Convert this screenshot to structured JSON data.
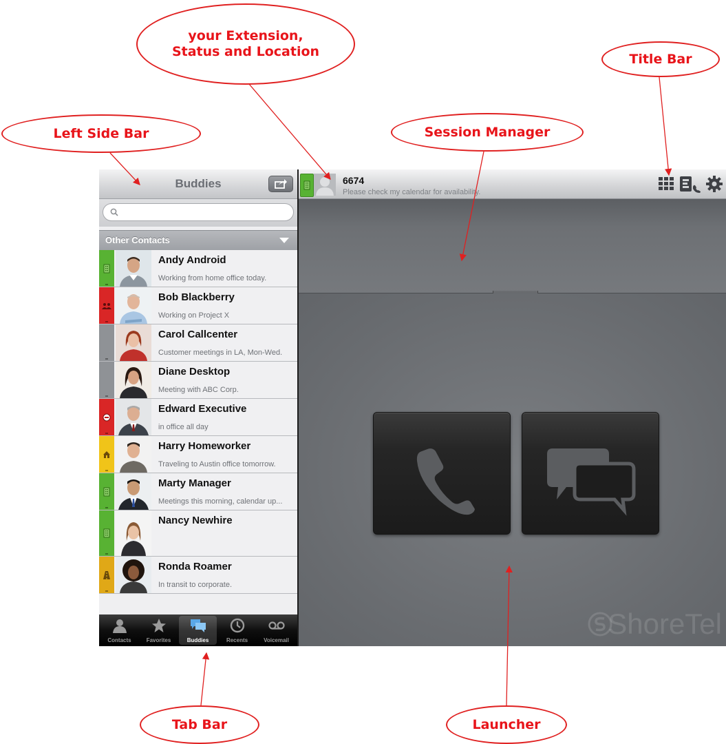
{
  "annotations": {
    "extension_status_location": [
      "your Extension,",
      "Status and Location"
    ],
    "title_bar": "Title Bar",
    "left_side_bar": "Left Side Bar",
    "session_manager": "Session Manager",
    "tab_bar": "Tab Bar",
    "launcher": "Launcher"
  },
  "sidebar": {
    "title": "Buddies",
    "search": {
      "placeholder": "",
      "value": ""
    },
    "group": "Other Contacts",
    "buddies": [
      {
        "name": "Andy Android",
        "status_text": "Working from home office today.",
        "status": "available",
        "color": "#58b233",
        "icon": "building-icon"
      },
      {
        "name": "Bob Blackberry",
        "status_text": "Working on Project X",
        "status": "in-meeting",
        "color": "#d92626",
        "icon": "people-icon"
      },
      {
        "name": "Carol Callcenter",
        "status_text": "Customer meetings in LA, Mon-Wed.",
        "status": "offline",
        "color": "#8f9296",
        "icon": ""
      },
      {
        "name": "Diane Desktop",
        "status_text": "Meeting with ABC Corp.",
        "status": "offline",
        "color": "#8f9296",
        "icon": ""
      },
      {
        "name": "Edward Executive",
        "status_text": "in office all day",
        "status": "do-not-disturb",
        "color": "#d92626",
        "icon": "minus-circle-icon"
      },
      {
        "name": "Harry Homeworker",
        "status_text": "Traveling to Austin office tomorrow.",
        "status": "working-from-home",
        "color": "#f0c419",
        "icon": "house-icon"
      },
      {
        "name": "Marty Manager",
        "status_text": "Meetings this morning, calendar up...",
        "status": "available",
        "color": "#58b233",
        "icon": "building-icon"
      },
      {
        "name": "Nancy Newhire",
        "status_text": "",
        "status": "available",
        "color": "#58b233",
        "icon": "building-icon"
      },
      {
        "name": "Ronda Roamer",
        "status_text": "In transit to corporate.",
        "status": "roaming",
        "color": "#e0a817",
        "icon": "road-icon"
      }
    ]
  },
  "tabbar": {
    "tabs": [
      {
        "label": "Contacts",
        "icon": "person-icon",
        "selected": false
      },
      {
        "label": "Favorites",
        "icon": "star-icon",
        "selected": false
      },
      {
        "label": "Buddies",
        "icon": "chat-bubbles-icon",
        "selected": true
      },
      {
        "label": "Recents",
        "icon": "clock-icon",
        "selected": false
      },
      {
        "label": "Voicemail",
        "icon": "voicemail-icon",
        "selected": false
      }
    ]
  },
  "titlebar": {
    "extension": "6674",
    "status_message": "Please check my calendar for availability.",
    "icons": [
      "dialpad-icon",
      "directory-phone-icon",
      "gear-icon"
    ]
  },
  "launcher": {
    "buttons": [
      {
        "icon": "phone-icon"
      },
      {
        "icon": "chat-icon"
      }
    ],
    "brand": "ShoreTel"
  }
}
